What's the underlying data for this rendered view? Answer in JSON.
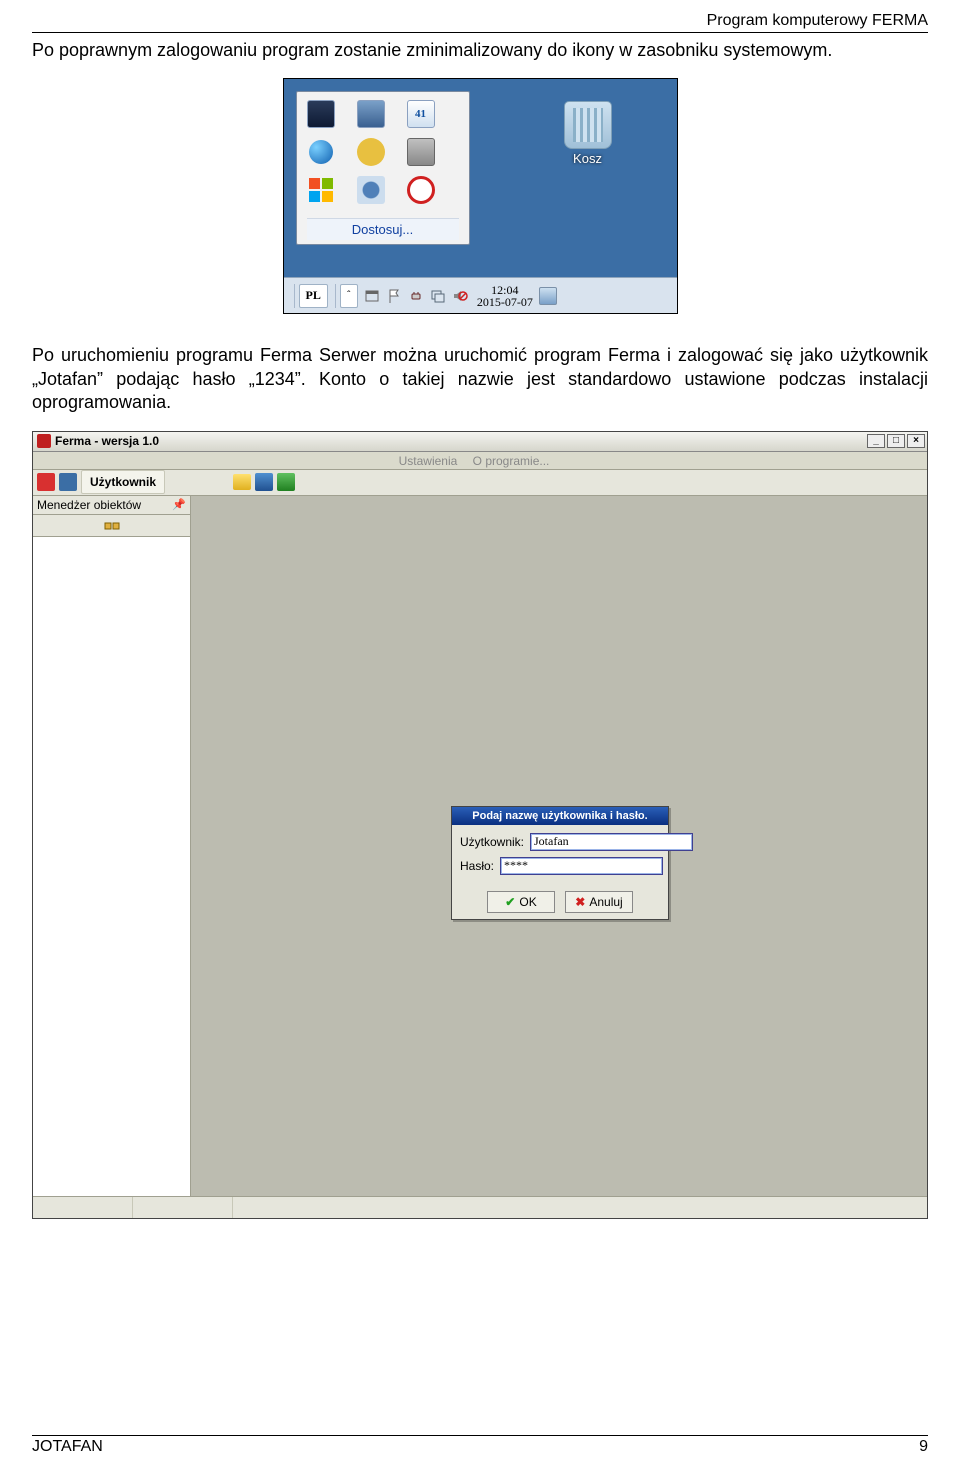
{
  "header": {
    "right": "Program komputerowy FERMA"
  },
  "para1": "Po poprawnym zalogowaniu program zostanie zminimalizowany do ikony w zasobniku systemowym.",
  "screenshot1": {
    "quicklaunch_date_badge": "41",
    "customize_link": "Dostosuj...",
    "recycle_bin": "Kosz",
    "lang": "PL",
    "chevron": "ˆ",
    "clock_time": "12:04",
    "clock_date": "2015-07-07"
  },
  "para2": "Po uruchomieniu programu Ferma Serwer można uruchomić program Ferma i zalogować się jako użytkownik „Jotafan” podając hasło „1234”. Konto o takiej nazwie jest standardowo ustawione podczas instalacji oprogramowania.",
  "app": {
    "title": "Ferma - wersja 1.0",
    "menu": {
      "item1": "Ustawienia",
      "item2": "O programie..."
    },
    "toolbar_user_btn": "Użytkownik",
    "sidepanel_title": "Menedżer obiektów",
    "pin_glyph": "📌",
    "login": {
      "title": "Podaj nazwę użytkownika i hasło.",
      "user_label": "Użytkownik:",
      "user_value": "Jotafan",
      "pass_label": "Hasło:",
      "pass_value": "****",
      "ok": "OK",
      "cancel": "Anuluj"
    },
    "winbtns": {
      "min": "_",
      "max": "□",
      "close": "×"
    }
  },
  "footer": {
    "left": "JOTAFAN",
    "right": "9"
  }
}
